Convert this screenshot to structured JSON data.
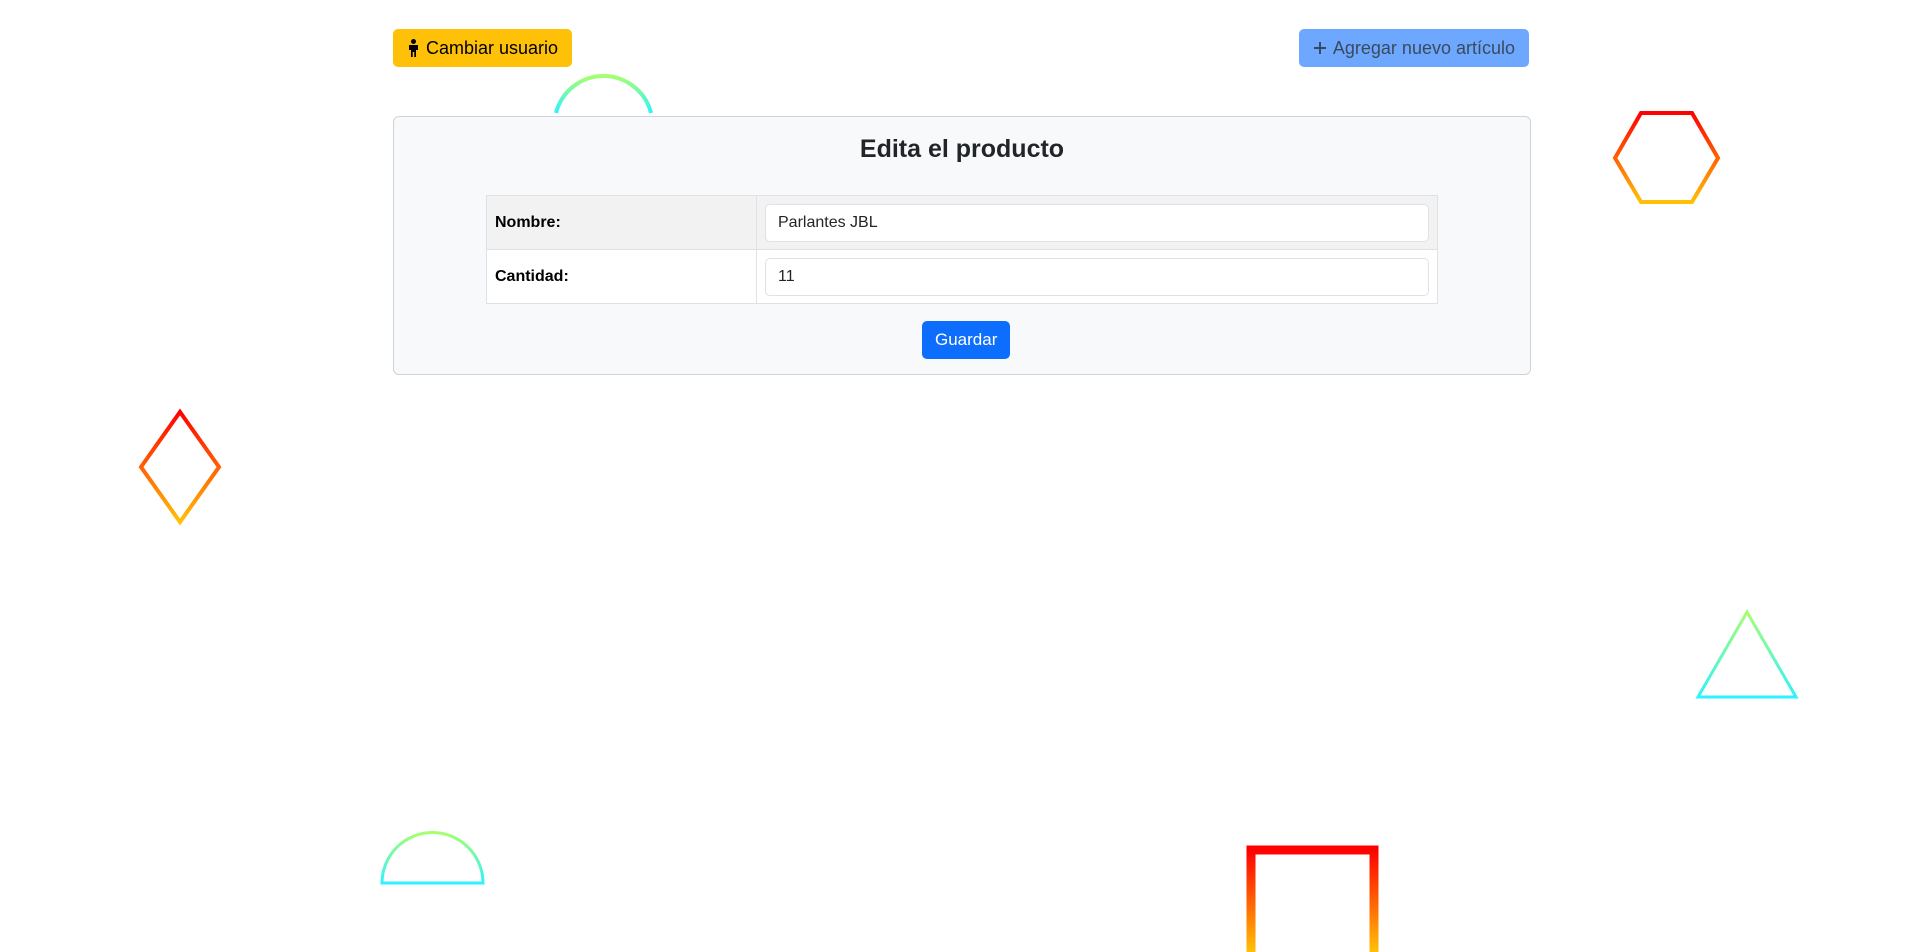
{
  "header": {
    "change_user_label": "Cambiar usuario",
    "change_user_icon": "person-standing-icon",
    "add_item_label": "Agregar nuevo artículo",
    "add_item_icon": "plus-icon"
  },
  "card": {
    "title": "Edita el producto",
    "fields": [
      {
        "label": "Nombre:",
        "value": "Parlantes JBL"
      },
      {
        "label": "Cantidad:",
        "value": "11"
      }
    ],
    "submit_label": "Guardar"
  },
  "colors": {
    "warning": "#ffc107",
    "primary": "#0d6efd",
    "primary_faded": "#6ea8fe",
    "shape_red": "#ff0000",
    "shape_yellow": "#ffc107",
    "shape_green": "#a6ff6e",
    "shape_cyan": "#2ef2ff"
  }
}
